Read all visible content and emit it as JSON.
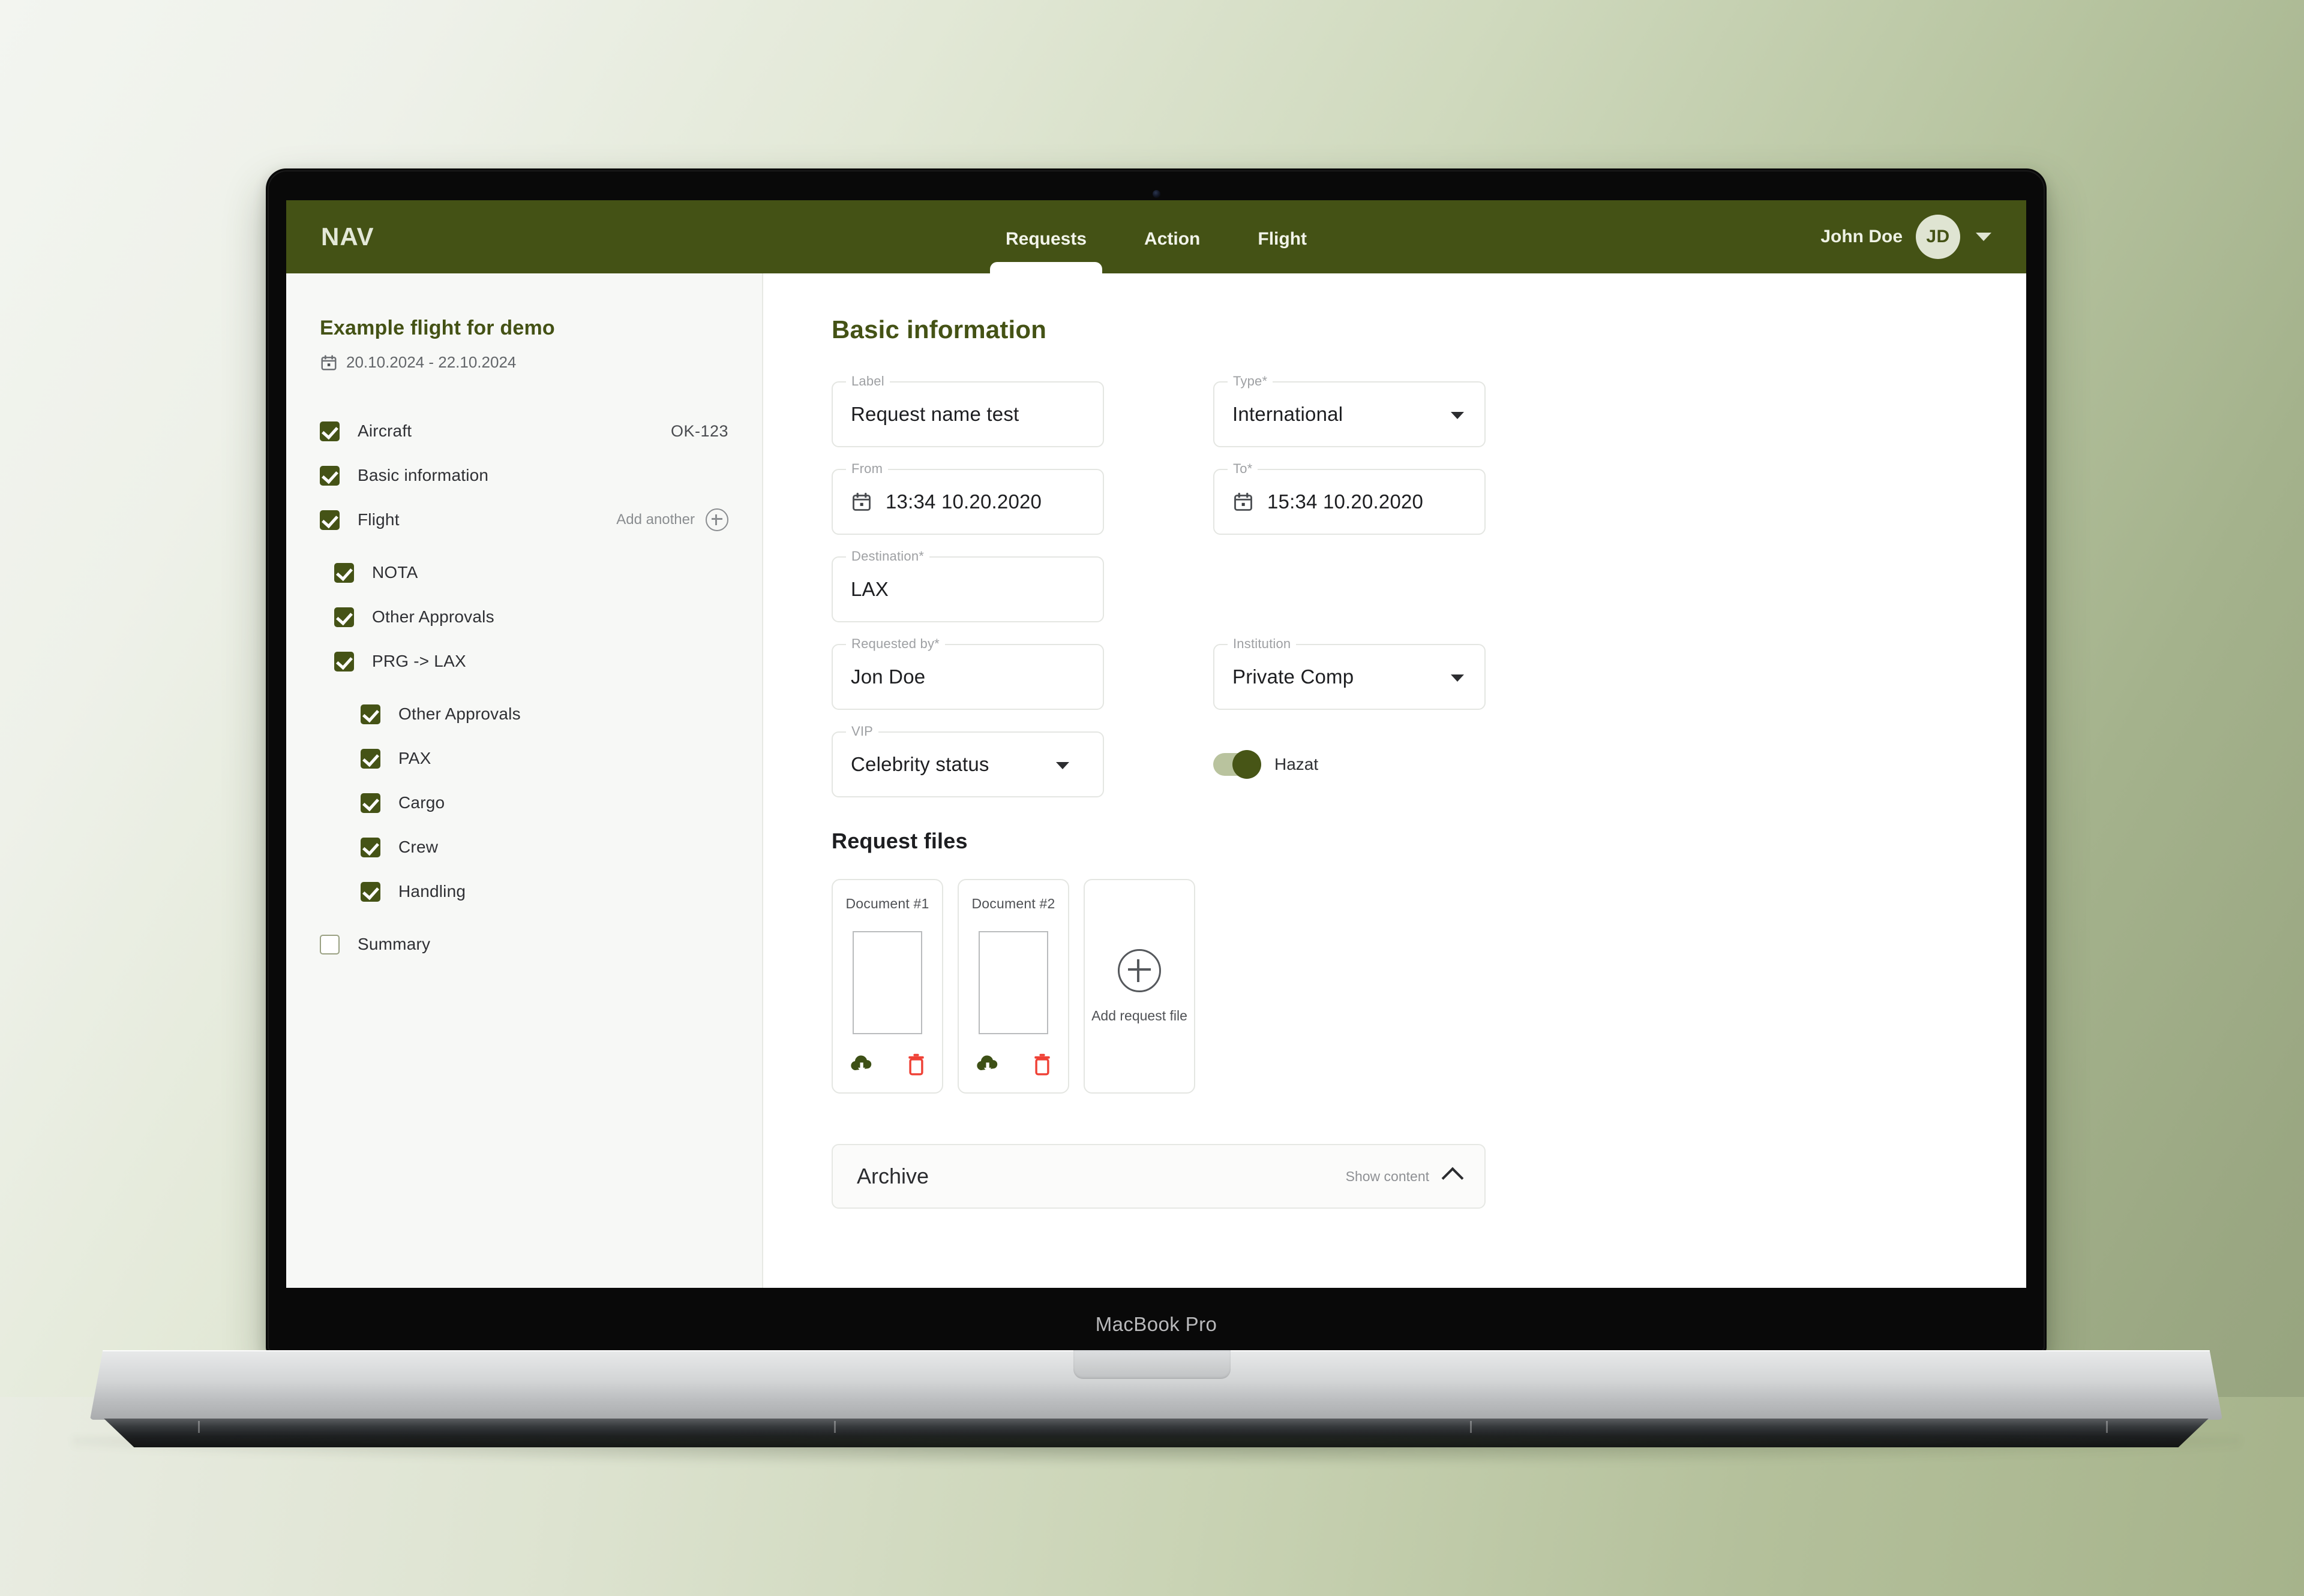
{
  "device": {
    "label": "MacBook Pro"
  },
  "topnav": {
    "brand": "NAV",
    "tabs": [
      {
        "label": "Requests",
        "active": true
      },
      {
        "label": "Action",
        "active": false
      },
      {
        "label": "Flight",
        "active": false
      }
    ],
    "user_name": "John Doe",
    "avatar_initials": "JD",
    "caret_icon": "chevron-down-icon",
    "bg_color": "#445215"
  },
  "sidebar": {
    "flight_title": "Example flight for demo",
    "date_range": "20.10.2024 - 22.10.2024",
    "calendar_icon": "calendar-icon",
    "items": [
      {
        "label": "Aircraft",
        "checked": true,
        "level": 0,
        "meta": "OK-123",
        "action": null
      },
      {
        "label": "Basic information",
        "checked": true,
        "level": 0,
        "meta": null,
        "action": null
      },
      {
        "label": "Flight",
        "checked": true,
        "level": 0,
        "meta": null,
        "action": "Add another"
      },
      {
        "label": "NOTA",
        "checked": true,
        "level": 1,
        "meta": null,
        "action": null
      },
      {
        "label": "Other Approvals",
        "checked": true,
        "level": 1,
        "meta": null,
        "action": null
      },
      {
        "label": "PRG -> LAX",
        "checked": true,
        "level": 1,
        "meta": null,
        "action": null
      },
      {
        "label": "Other Approvals",
        "checked": true,
        "level": 2,
        "meta": null,
        "action": null
      },
      {
        "label": "PAX",
        "checked": true,
        "level": 2,
        "meta": null,
        "action": null
      },
      {
        "label": "Cargo",
        "checked": true,
        "level": 2,
        "meta": null,
        "action": null
      },
      {
        "label": "Crew",
        "checked": true,
        "level": 2,
        "meta": null,
        "action": null
      },
      {
        "label": "Handling",
        "checked": true,
        "level": 2,
        "meta": null,
        "action": null
      },
      {
        "label": "Summary",
        "checked": false,
        "level": 0,
        "meta": null,
        "action": null
      }
    ]
  },
  "main": {
    "title": "Basic information",
    "fields": {
      "label": {
        "label": "Label",
        "value": "Request name test"
      },
      "type": {
        "label": "Type*",
        "value": "International"
      },
      "from": {
        "label": "From",
        "value": "13:34 10.20.2020"
      },
      "to": {
        "label": "To*",
        "value": "15:34 10.20.2020"
      },
      "destination": {
        "label": "Destination*",
        "value": "LAX"
      },
      "requested_by": {
        "label": "Requested by*",
        "value": "Jon Doe"
      },
      "institution": {
        "label": "Institution",
        "value": "Private Comp"
      },
      "vip": {
        "label": "VIP",
        "value": "Celebrity status"
      }
    },
    "hazat": {
      "label": "Hazat",
      "on": true
    },
    "files_title": "Request files",
    "files": [
      {
        "title": "Document #1",
        "download_icon": "cloud-download-icon",
        "delete_icon": "trash-icon"
      },
      {
        "title": "Document #2",
        "download_icon": "cloud-download-icon",
        "delete_icon": "trash-icon"
      }
    ],
    "add_file": {
      "label": "Add request file",
      "icon": "plus-circle-icon"
    },
    "archive": {
      "title": "Archive",
      "action": "Show content",
      "chevron": "chevron-up-icon"
    }
  },
  "colors": {
    "brand_green": "#445215",
    "checkbox_green": "#455316",
    "download_green": "#3d5016",
    "delete_red": "#ef4136"
  }
}
